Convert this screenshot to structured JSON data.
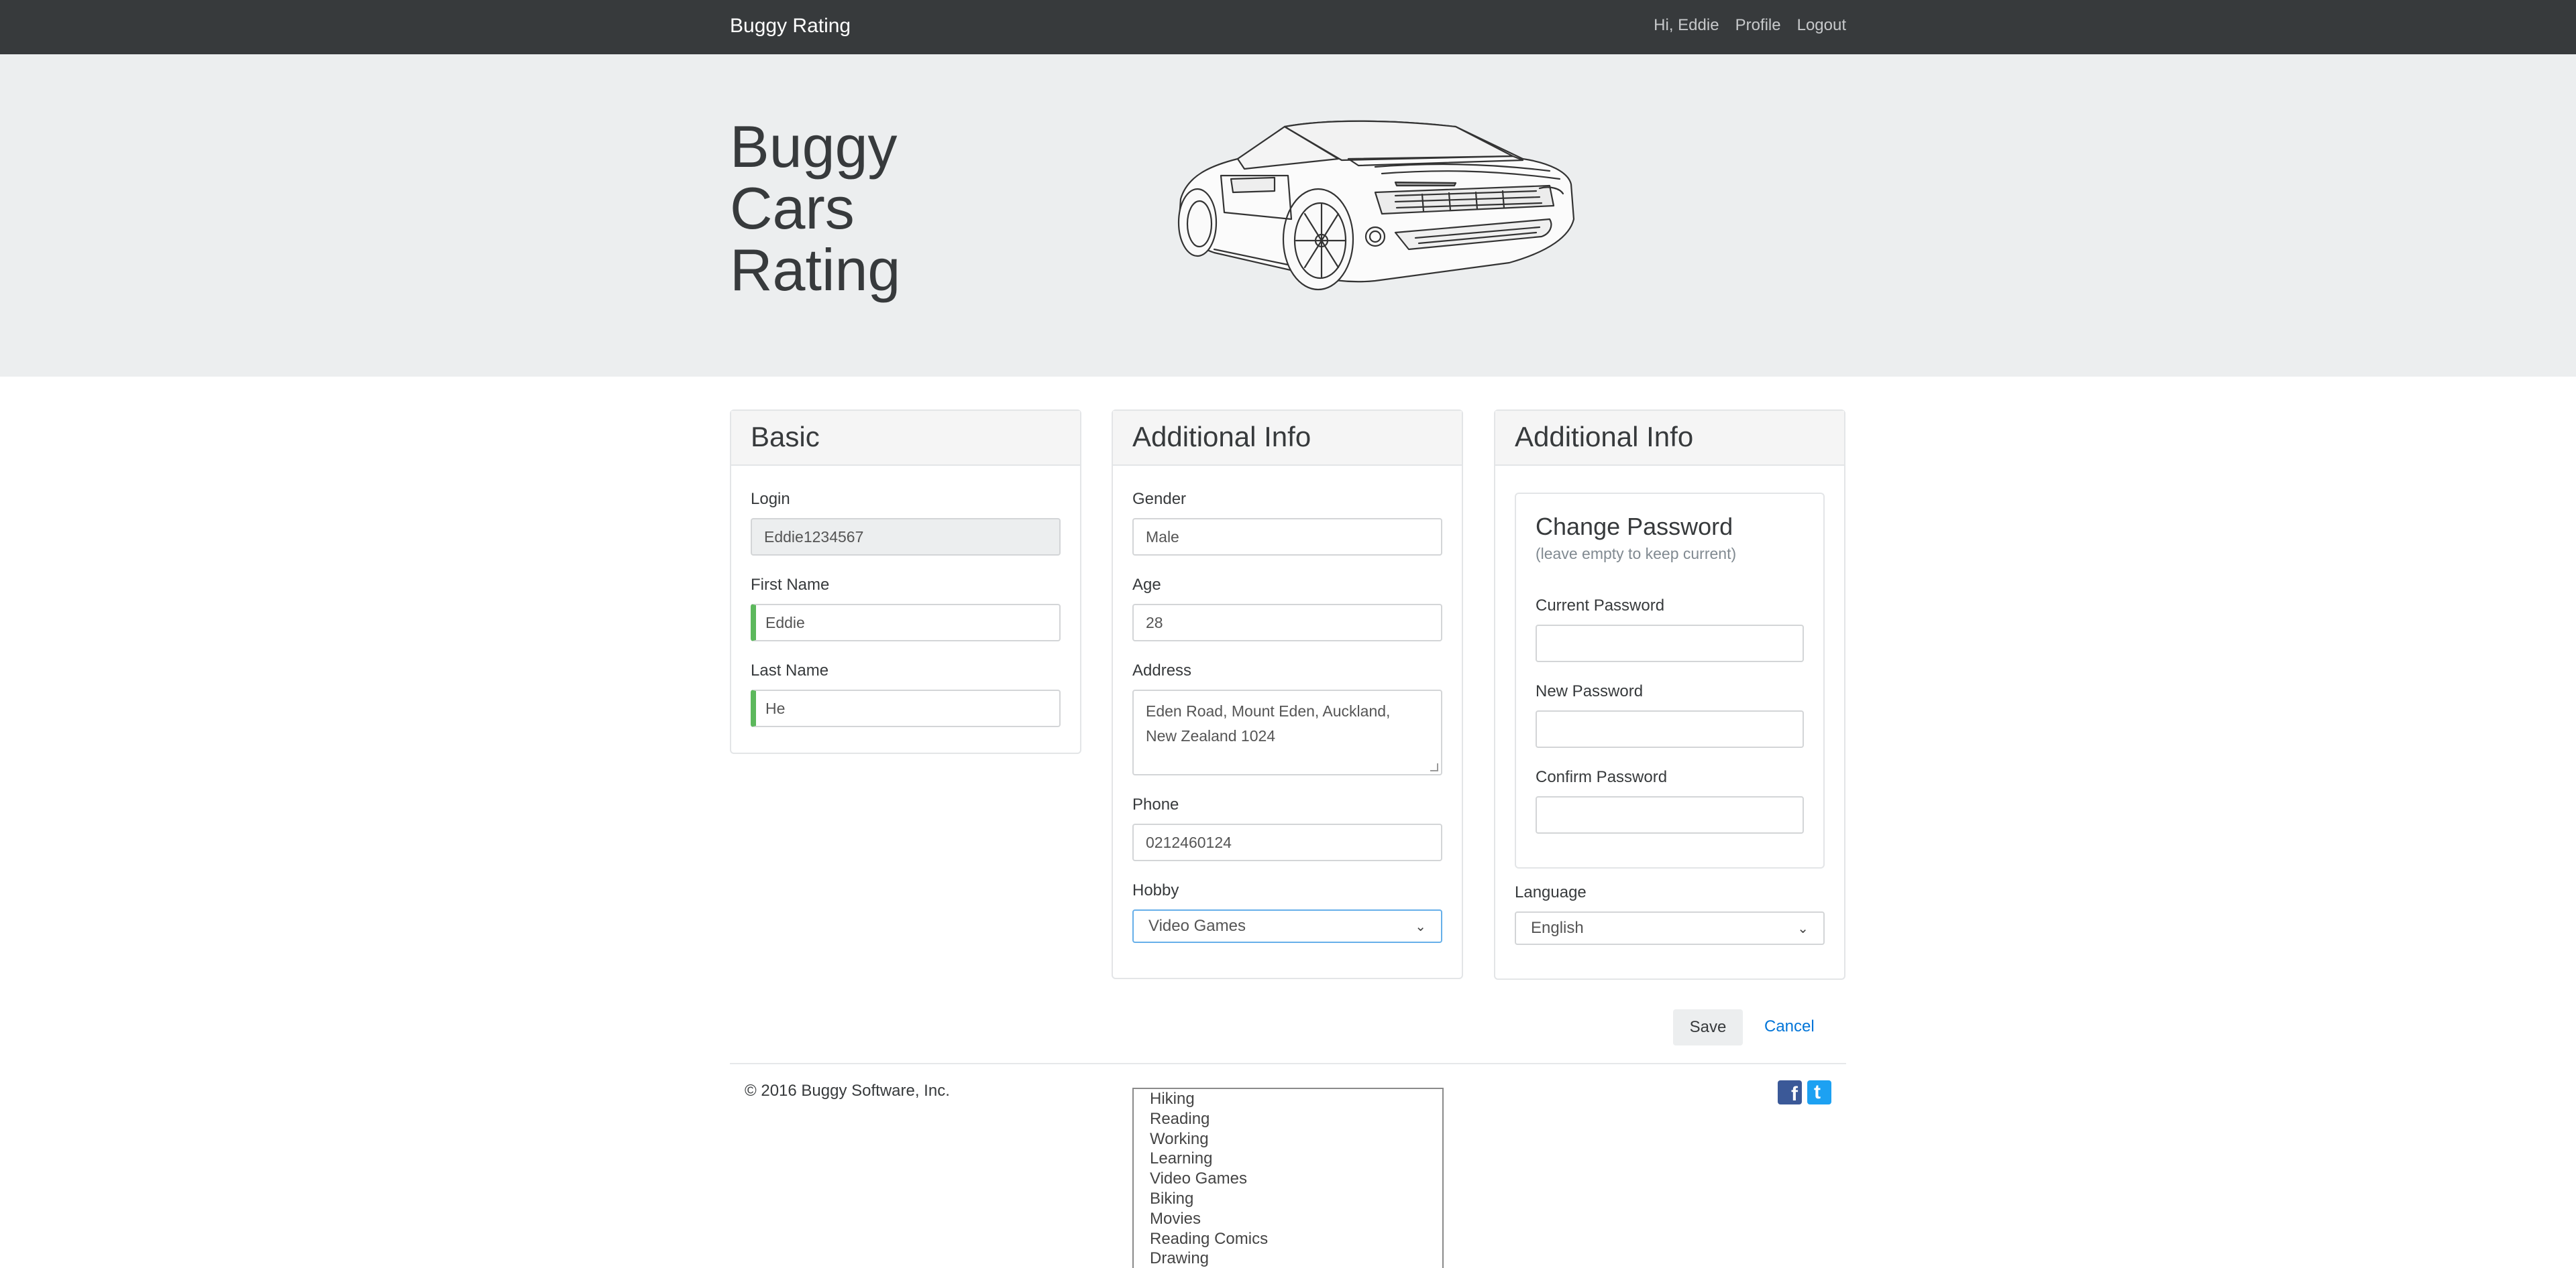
{
  "navbar": {
    "brand": "Buggy Rating",
    "greeting": "Hi, Eddie",
    "profile": "Profile",
    "logout": "Logout"
  },
  "hero": {
    "title_lines": [
      "Buggy",
      "Cars",
      "Rating"
    ]
  },
  "basic": {
    "header": "Basic",
    "login_label": "Login",
    "login_value": "Eddie1234567",
    "first_name_label": "First Name",
    "first_name_value": "Eddie",
    "last_name_label": "Last Name",
    "last_name_value": "He"
  },
  "additional": {
    "header": "Additional Info",
    "gender_label": "Gender",
    "gender_value": "Male",
    "age_label": "Age",
    "age_value": "28",
    "address_label": "Address",
    "address_line1": "Eden Road, Mount Eden, Auckland,",
    "address_line2": "New Zealand 1024",
    "phone_label": "Phone",
    "phone_value": "0212460124",
    "hobby_label": "Hobby",
    "hobby_value": "Video Games"
  },
  "password": {
    "header": "Additional Info",
    "title": "Change Password",
    "subtitle": "(leave empty to keep current)",
    "current_label": "Current Password",
    "new_label": "New Password",
    "confirm_label": "Confirm Password",
    "language_label": "Language",
    "language_value": "English"
  },
  "actions": {
    "save": "Save",
    "cancel": "Cancel"
  },
  "footer": {
    "copyright": "© 2016 Buggy Software, Inc.",
    "facebook_icon": "facebook-icon",
    "twitter_icon": "twitter-icon"
  },
  "hobby_options": [
    "Hiking",
    "Reading",
    "Working",
    "Learning",
    "Video Games",
    "Biking",
    "Movies",
    "Reading Comics",
    "Drawing"
  ],
  "colors": {
    "navbar": "#373a3c",
    "jumbotron": "#eceeef",
    "valid": "#5cb85c",
    "link": "#0275d8",
    "focus": "#66afe9"
  }
}
